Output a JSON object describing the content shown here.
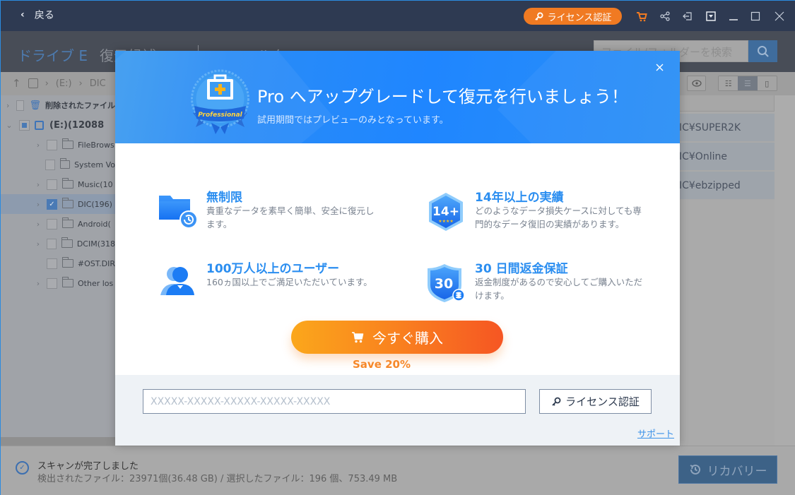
{
  "titlebar": {
    "back_label": "戻る",
    "license_label": "ライセンス認証",
    "icons": [
      "cart-icon",
      "share-icon",
      "export-icon",
      "menu-dropdown-icon",
      "minimize-icon",
      "maximize-icon",
      "close-icon"
    ],
    "cart_color": "#f07a22"
  },
  "nav": {
    "tabs": [
      {
        "label": "ドライブ E",
        "active": true
      },
      {
        "label": "復元候補",
        "active": false
      },
      {
        "label": "フィルタ",
        "active": false
      }
    ],
    "search_placeholder": "ファイル/フォルダーを検索"
  },
  "breadcrumb": {
    "items": [
      "(E:)",
      "DIC"
    ]
  },
  "tree": {
    "items": [
      {
        "label": "削除されたファイル",
        "level": 0,
        "expandable": true,
        "state": "unchecked",
        "icon": "trash-icon",
        "bold": true
      },
      {
        "label": "(E:)(12088",
        "level": 0,
        "expandable": true,
        "expanded": true,
        "state": "partial",
        "icon": "drive-icon",
        "bold": true
      },
      {
        "label": "FileBrows",
        "level": 1,
        "expandable": true,
        "state": "unchecked"
      },
      {
        "label": "System Vo",
        "level": 1,
        "expandable": false,
        "state": "unchecked"
      },
      {
        "label": "Music(10",
        "level": 1,
        "expandable": true,
        "state": "unchecked"
      },
      {
        "label": "DIC(196)",
        "level": 1,
        "expandable": true,
        "state": "checked",
        "selected": true
      },
      {
        "label": "Android(",
        "level": 1,
        "expandable": true,
        "state": "unchecked"
      },
      {
        "label": "DCIM(318",
        "level": 1,
        "expandable": true,
        "state": "unchecked"
      },
      {
        "label": "#OST.DIR",
        "level": 1,
        "expandable": false,
        "state": "unchecked"
      },
      {
        "label": "Other los",
        "level": 1,
        "expandable": true,
        "state": "unchecked"
      }
    ]
  },
  "file_list": {
    "rows": [
      "IC¥SUPER2K",
      "IC¥Online",
      "IC¥ebzipped"
    ]
  },
  "status": {
    "title": "スキャンが完了しました",
    "detail": "検出されたファイル：23971個(36.48 GB) / 選択したファイル：196  個、753.49 MB",
    "recover_label": "リカバリー"
  },
  "modal": {
    "badge_text": "Professional",
    "title": "Pro へアップグレードして復元を行いましょう！",
    "subtitle": "試用期間ではプレビューのみとなっています。",
    "features": [
      {
        "title": "無制限",
        "desc": "貴重なデータを素早く簡単、安全に復元します。",
        "icon": "folder-restore-icon"
      },
      {
        "title": "14年以上の実績",
        "desc": "どのようなデータ損失ケースに対しても専門的なデータ復旧の実績があります。",
        "icon": "14-plus-badge-icon",
        "badge": "14+"
      },
      {
        "title": "100万人以上のユーザー",
        "desc": "160ヵ国以上でご満足いただいています。",
        "icon": "users-icon"
      },
      {
        "title": "30 日間返金保証",
        "desc": "返金制度があるので安心してご購入いただけます。",
        "icon": "shield-30-icon",
        "badge": "30"
      }
    ],
    "buy_label": "今すぐ購入",
    "save_text": "Save 20%",
    "license_key_placeholder": "XXXXX-XXXXX-XXXXX-XXXXX-XXXXX",
    "license_key_value": "",
    "license_button_label": "ライセンス認証",
    "support_label": "サポート",
    "accent_color": "#2b8ef0",
    "buy_gradient": [
      "#fba71b",
      "#f65623"
    ]
  }
}
